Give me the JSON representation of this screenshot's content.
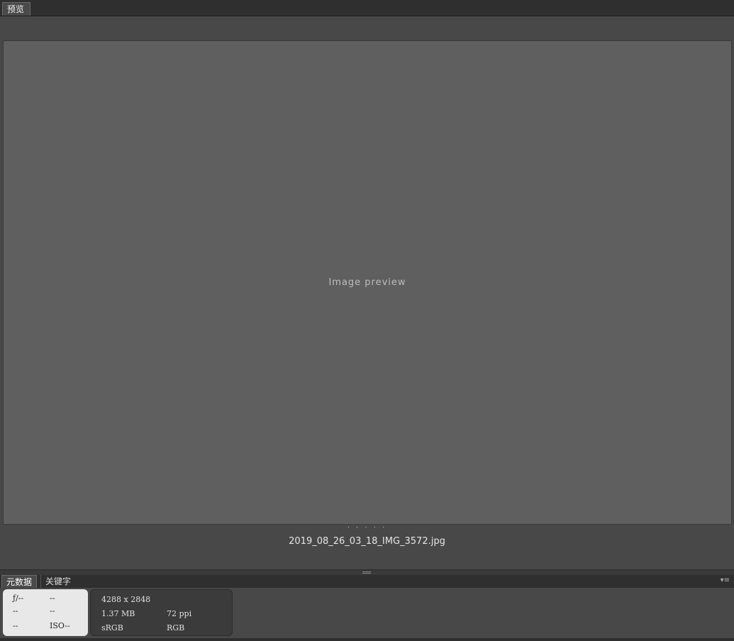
{
  "panel": {
    "tab_label": "预览"
  },
  "preview": {
    "placeholder": "Image preview",
    "dots": "· · · · ·",
    "filename": "2019_08_26_03_18_IMG_3572.jpg"
  },
  "bottom_tabs": {
    "metadata": "元数据",
    "keywords": "关键字",
    "menu_icon": "▾≡"
  },
  "camera": {
    "aperture": "ƒ/--",
    "shutter": "--",
    "exposure_comp": "--",
    "metering": "--",
    "white_balance": "--",
    "iso": "ISO--"
  },
  "file_info": {
    "dimensions": "4288 x 2848",
    "size": "1.37 MB",
    "resolution": "72 ppi",
    "color_profile": "sRGB",
    "color_mode": "RGB"
  }
}
